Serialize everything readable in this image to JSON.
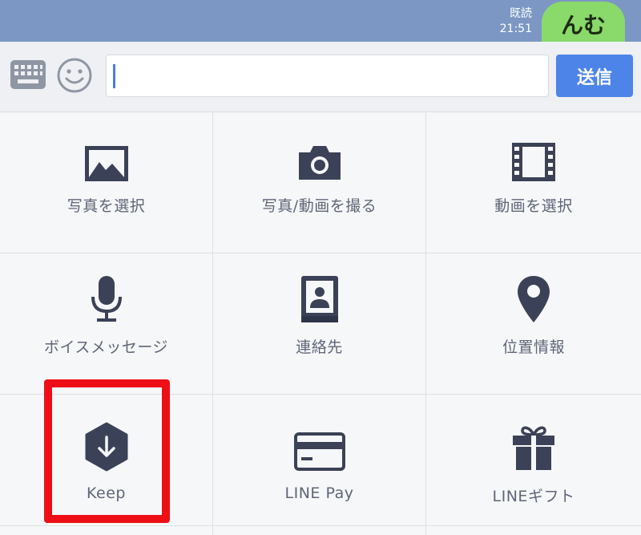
{
  "chat": {
    "read_label": "既読",
    "time": "21:51",
    "bubble_text": "んむ"
  },
  "input_bar": {
    "text_value": "",
    "send_label": "送信"
  },
  "menu": [
    {
      "label": "写真を選択",
      "icon": "image-icon"
    },
    {
      "label": "写真/動画を撮る",
      "icon": "camera-icon"
    },
    {
      "label": "動画を選択",
      "icon": "film-icon"
    },
    {
      "label": "ボイスメッセージ",
      "icon": "microphone-icon"
    },
    {
      "label": "連絡先",
      "icon": "contact-book-icon"
    },
    {
      "label": "位置情報",
      "icon": "location-pin-icon"
    },
    {
      "label": "Keep",
      "icon": "keep-icon"
    },
    {
      "label": "LINE Pay",
      "icon": "credit-card-icon"
    },
    {
      "label": "LINEギフト",
      "icon": "gift-icon"
    }
  ],
  "colors": {
    "chat_background": "#7c97c3",
    "bubble": "#8ad96b",
    "send_button": "#4d84e8",
    "icon": "#3b4257",
    "highlight": "#ee0f16"
  }
}
